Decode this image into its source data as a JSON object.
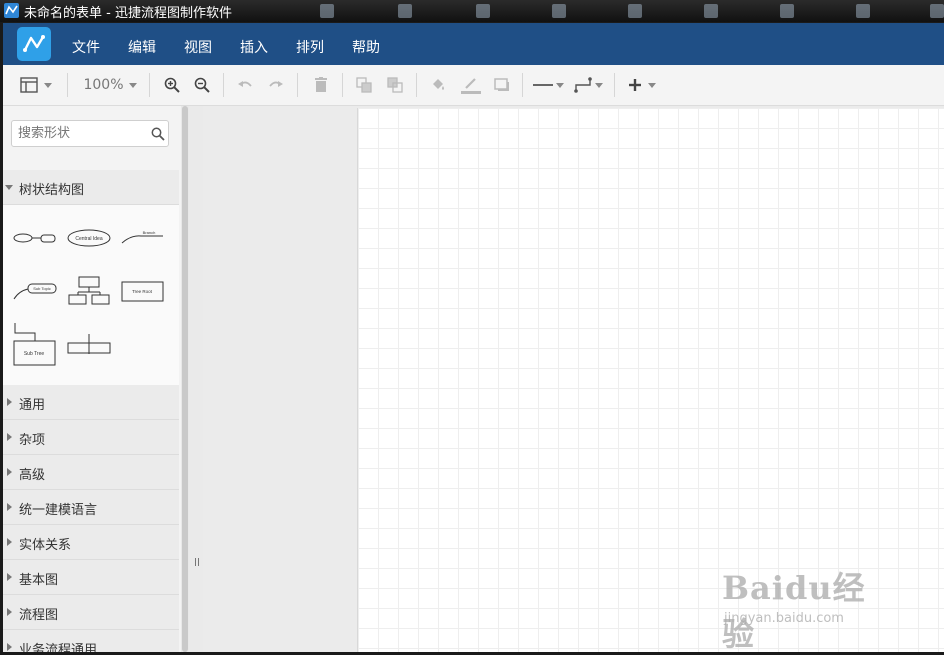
{
  "window": {
    "title": "未命名的表单 - 迅捷流程图制作软件"
  },
  "menu": [
    "文件",
    "编辑",
    "视图",
    "插入",
    "排列",
    "帮助"
  ],
  "toolbar": {
    "zoom": "100%",
    "icons": [
      "format-panel-icon",
      "zoom-in-icon",
      "zoom-out-icon",
      "undo-icon",
      "redo-icon",
      "delete-icon",
      "to-front-icon",
      "to-back-icon",
      "fill-color-icon",
      "line-color-icon",
      "shadow-icon",
      "line-style-icon",
      "waypoint-icon",
      "insert-plus-icon"
    ]
  },
  "sidebar": {
    "search_placeholder": "搜索形状",
    "open_section": "树状结构图",
    "shapes": [
      {
        "name": "tree-shape-bubble",
        "label": ""
      },
      {
        "name": "tree-shape-central-idea",
        "label": "Central Idea"
      },
      {
        "name": "tree-shape-branch",
        "label": "Branch"
      },
      {
        "name": "tree-shape-sub-topic",
        "label": "Sub Topic"
      },
      {
        "name": "tree-shape-org",
        "label": ""
      },
      {
        "name": "tree-shape-tree-root",
        "label": "Tree Root"
      },
      {
        "name": "tree-shape-sub-tree",
        "label": "Sub Tree"
      },
      {
        "name": "tree-shape-horizontal",
        "label": ""
      }
    ],
    "sections": [
      "通用",
      "杂项",
      "高级",
      "统一建模语言",
      "实体关系",
      "基本图",
      "流程图",
      "业务流程通用"
    ]
  },
  "watermark": {
    "brand": "Baidu经验",
    "url": "jingyan.baidu.com"
  },
  "colors": {
    "menubar": "#1f4f86",
    "logo": "#2fa0e8"
  }
}
